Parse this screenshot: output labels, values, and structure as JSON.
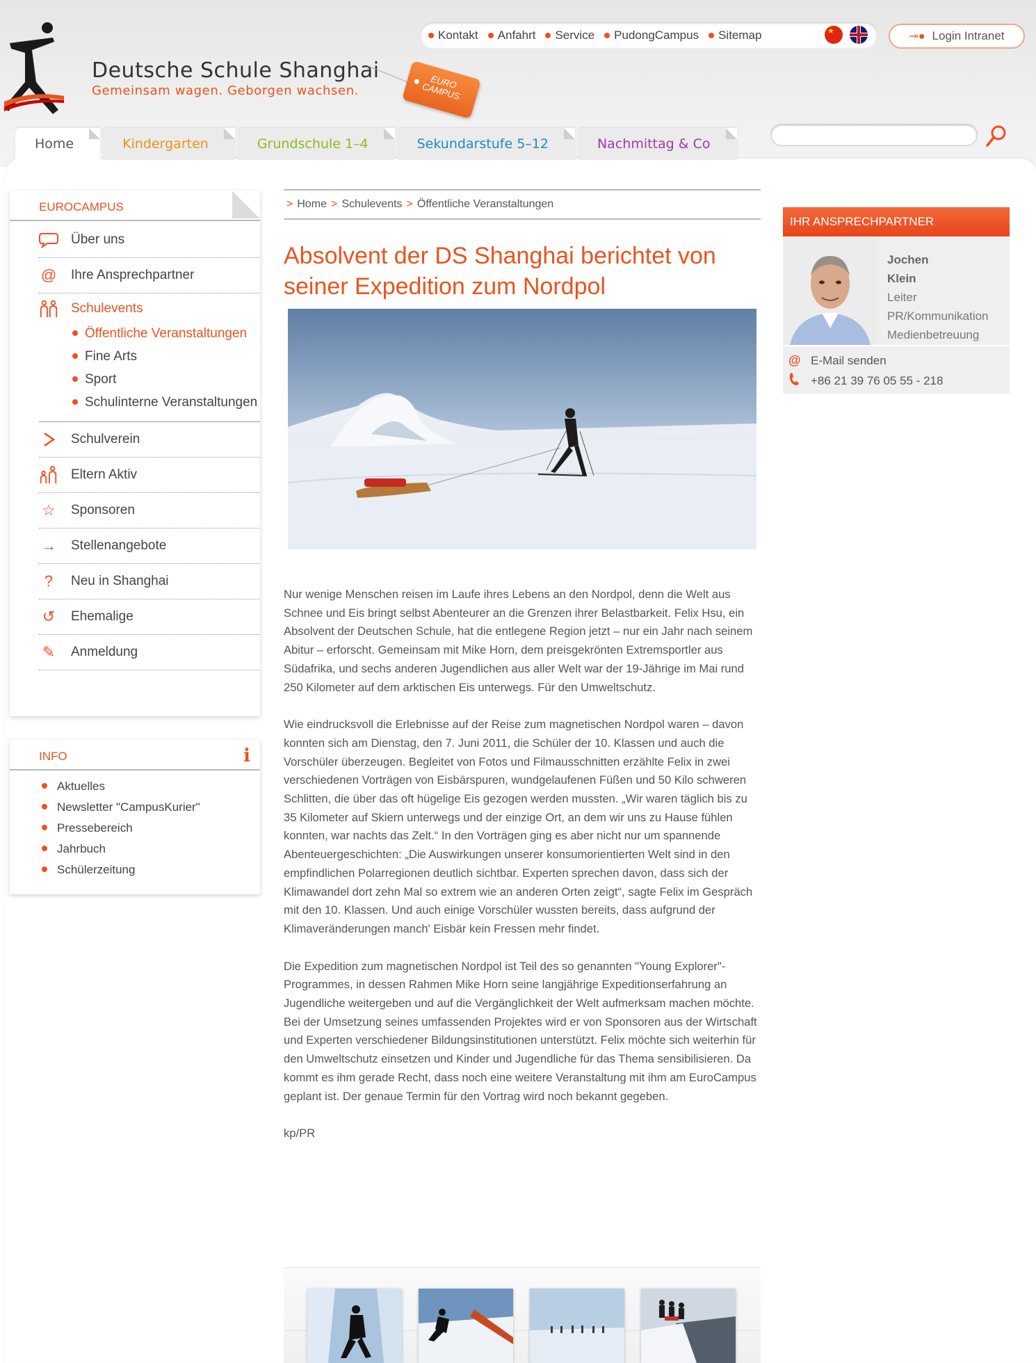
{
  "header": {
    "title": "Deutsche Schule Shanghai",
    "slogan": "Gemeinsam wagen. Geborgen wachsen.",
    "tag_line1": "EURO",
    "tag_line2": "CAMPUS",
    "topnav": [
      "Kontakt",
      "Anfahrt",
      "Service",
      "PudongCampus",
      "Sitemap"
    ],
    "login_label": "Login Intranet",
    "search_placeholder": ""
  },
  "tabs": [
    "Home",
    "Kindergarten",
    "Grundschule 1–4",
    "Sekundarstufe 5–12",
    "Nachmittag & Co"
  ],
  "sidebar": {
    "heading": "EUROCAMPUS",
    "items": [
      {
        "label": "Über uns",
        "icon": "speech-bubble-icon"
      },
      {
        "label": "Ihre Ansprechpartner",
        "icon": "at-sign-icon"
      },
      {
        "label": "Schulevents",
        "icon": "people-icon"
      },
      {
        "label": "Schulverein",
        "icon": "play-triangle-icon"
      },
      {
        "label": "Eltern Aktiv",
        "icon": "parent-child-icon"
      },
      {
        "label": "Sponsoren",
        "icon": "star-icon"
      },
      {
        "label": "Stellenangebote",
        "icon": "arrow-right-icon"
      },
      {
        "label": "Neu in Shanghai",
        "icon": "question-mark-icon"
      },
      {
        "label": "Ehemalige",
        "icon": "return-arrow-icon"
      },
      {
        "label": "Anmeldung",
        "icon": "pencil-icon"
      }
    ],
    "subitems": [
      "Öffentliche Veranstaltungen",
      "Fine Arts",
      "Sport",
      "Schulinterne Veranstaltungen"
    ]
  },
  "info": {
    "heading": "INFO",
    "items": [
      "Aktuelles",
      "Newsletter \"CampusKurier\"",
      "Pressebereich",
      "Jahrbuch",
      "Schülerzeitung"
    ]
  },
  "breadcrumb": [
    "Home",
    "Schulevents",
    "Öffentliche Veranstaltungen"
  ],
  "article": {
    "title": "Absolvent der DS Shanghai berichtet von seiner Expedition zum Nordpol",
    "paragraphs": [
      "Nur wenige Menschen reisen im Laufe ihres Lebens an den Nordpol, denn die Welt aus Schnee und Eis bringt selbst Abenteurer an die Grenzen ihrer Belastbarkeit. Felix Hsu, ein Absolvent der Deutschen Schule, hat die entlegene Region jetzt – nur ein Jahr nach seinem Abitur – erforscht. Gemeinsam mit Mike Horn, dem preisgekrönten Extremsportler aus Südafrika, und sechs anderen Jugendlichen aus aller Welt war der 19-Jährige im Mai rund 250 Kilometer auf dem arktischen Eis unterwegs. Für den Umweltschutz.",
      "Wie eindrucksvoll die Erlebnisse auf der Reise zum magnetischen Nordpol waren – davon konnten sich am Dienstag, den 7. Juni 2011, die Schüler der 10. Klassen und auch die Vorschüler überzeugen. Begleitet von Fotos und Filmausschnitten erzählte Felix in zwei verschiedenen Vorträgen von Eisbärspuren, wundgelaufenen Füßen und 50 Kilo schweren Schlitten, die über das oft hügelige Eis gezogen werden mussten. „Wir waren täglich bis zu 35 Kilometer auf Skiern unterwegs und der einzige Ort, an dem wir uns zu Hause fühlen konnten, war nachts das Zelt.“ In den Vorträgen ging es aber nicht nur um spannende Abenteuergeschichten: „Die Auswirkungen unserer konsumorientierten Welt sind in den empfindlichen Polarregionen deutlich sichtbar. Experten sprechen davon, dass sich der Klimawandel dort zehn Mal so extrem wie an anderen Orten zeigt“, sagte Felix im Gespräch mit den 10. Klassen. Und auch einige Vorschüler wussten bereits, dass aufgrund der Klimaveränderungen manch' Eisbär kein Fressen mehr findet.",
      "Die Expedition zum magnetischen Nordpol ist Teil des so genannten \"Young Explorer\"-Programmes, in dessen Rahmen Mike Horn seine langjährige Expeditionserfahrung an Jugendliche weitergeben und auf die Vergänglichkeit der Welt aufmerksam machen möchte. Bei der Umsetzung seines umfassenden Projektes wird er von Sponsoren aus der Wirtschaft und Experten verschiedener Bildungsinstitutionen unterstützt. Felix möchte sich weiterhin für den Umweltschutz einsetzen und Kinder und Jugendliche für das Thema sensibilisieren. Da kommt es ihm gerade Recht, dass noch eine weitere Veranstaltung mit ihm am EuroCampus geplant ist. Der genaue Termin für den Vortrag wird noch bekannt gegeben.",
      "kp/PR"
    ]
  },
  "contact": {
    "heading": "IHR ANSPRECHPARTNER",
    "first_name": "Jochen",
    "last_name": "Klein",
    "role_lines": [
      "Leiter",
      "PR/Kommunikation",
      "Medienbetreuung"
    ],
    "email_label": "E-Mail senden",
    "phone": "+86 21 39 76 05 55 - 218"
  },
  "colors": {
    "accent": "#e8541e",
    "kindergarten": "#f39018",
    "grundschule": "#8dbb1e",
    "sekundarstufe": "#1d8ac8",
    "nachmittag": "#9c3da8"
  }
}
